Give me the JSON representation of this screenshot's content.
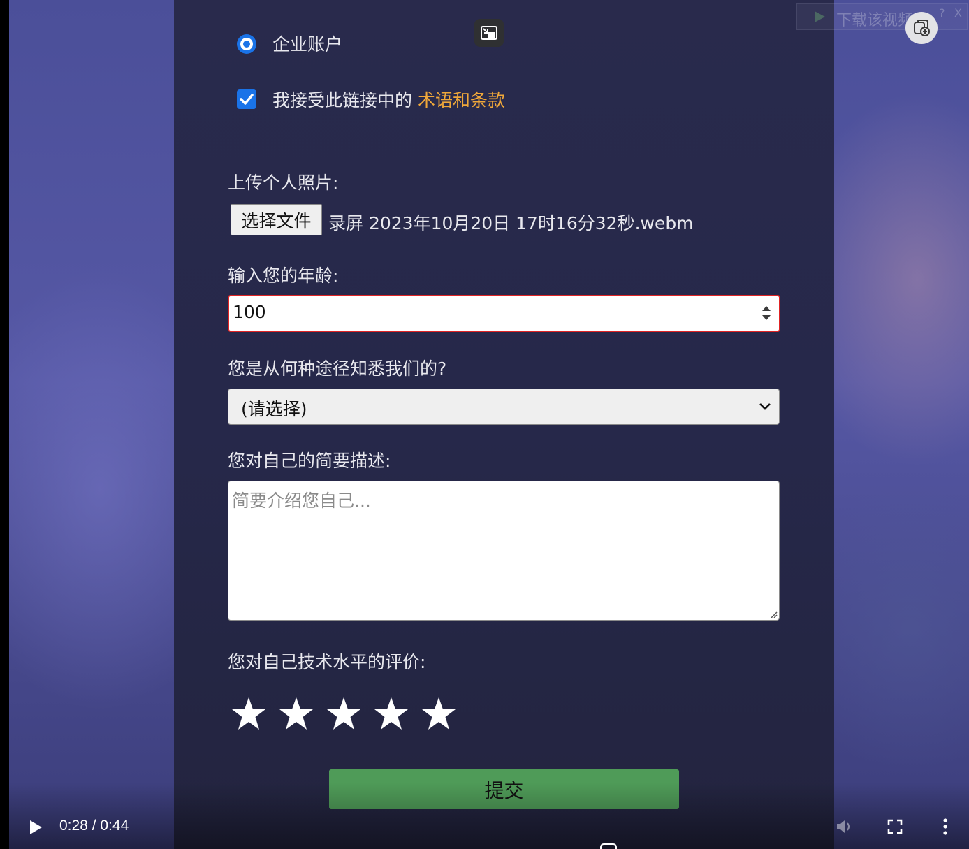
{
  "form": {
    "radio_enterprise_label": "企业账户",
    "terms_text": "我接受此链接中的",
    "terms_link": "术语和条款",
    "upload_label": "上传个人照片:",
    "file_button": "选择文件",
    "file_name": "录屏 2023年10月20日 17时16分32秒.webm",
    "age_label": "输入您的年龄:",
    "age_value": "100",
    "source_label": "您是从何种途径知悉我们的?",
    "source_selected": "(请选择)",
    "desc_label": "您对自己的简要描述:",
    "desc_placeholder": "简要介绍您自己...",
    "rating_label": "您对自己技术水平的评价:",
    "rating_stars": 5,
    "submit_label": "提交"
  },
  "video": {
    "time": "0:28 / 0:44"
  },
  "overlay": {
    "download_text": "下载该视频",
    "help": "?",
    "close": "X"
  },
  "colors": {
    "accent": "#1a73e8",
    "link": "#f0a83a",
    "submit": "#4f9b58",
    "error_border": "#e02424"
  }
}
